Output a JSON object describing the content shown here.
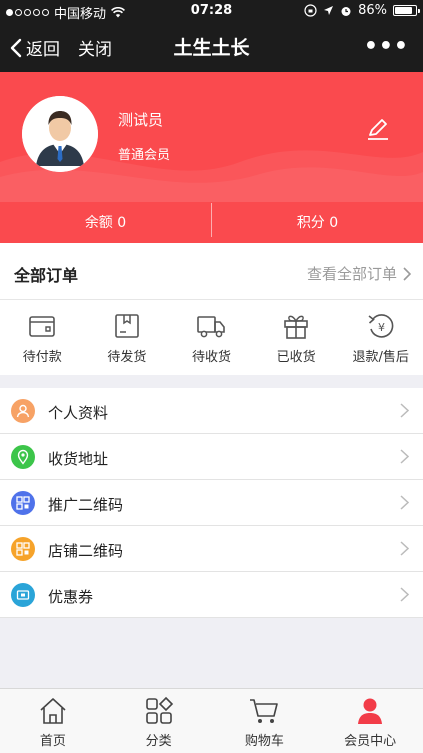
{
  "status_bar": {
    "carrier": "中国移动",
    "time": "07:28",
    "battery": "86%",
    "battery_level": 0.86
  },
  "nav": {
    "back_label": "返回",
    "close_label": "关闭",
    "title": "土生土长",
    "more_label": "•••"
  },
  "profile": {
    "name": "测试员",
    "level": "普通会员",
    "balance_label": "余额 0",
    "points_label": "积分 0",
    "accent_color": "#fa4a4e"
  },
  "orders": {
    "title": "全部订单",
    "view_all": "查看全部订单",
    "items": [
      {
        "label": "待付款",
        "icon": "wallet-icon"
      },
      {
        "label": "待发货",
        "icon": "package-icon"
      },
      {
        "label": "待收货",
        "icon": "truck-icon"
      },
      {
        "label": "已收货",
        "icon": "gift-icon"
      },
      {
        "label": "退款/售后",
        "icon": "yen-refund-icon"
      }
    ]
  },
  "menu": [
    {
      "label": "个人资料",
      "icon": "person-icon",
      "color": "#f7a265"
    },
    {
      "label": "收货地址",
      "icon": "location-pin-icon",
      "color": "#3cc54a"
    },
    {
      "label": "推广二维码",
      "icon": "qr-code-icon",
      "color": "#4f72ea"
    },
    {
      "label": "店铺二维码",
      "icon": "qr-code-icon",
      "color": "#f6a32a"
    },
    {
      "label": "优惠券",
      "icon": "coupon-icon",
      "color": "#2aa4d8"
    }
  ],
  "tabbar": [
    {
      "label": "首页",
      "icon": "home-icon"
    },
    {
      "label": "分类",
      "icon": "category-icon"
    },
    {
      "label": "购物车",
      "icon": "cart-icon"
    },
    {
      "label": "会员中心",
      "icon": "member-icon",
      "active": true,
      "active_color": "#f23c48"
    }
  ]
}
